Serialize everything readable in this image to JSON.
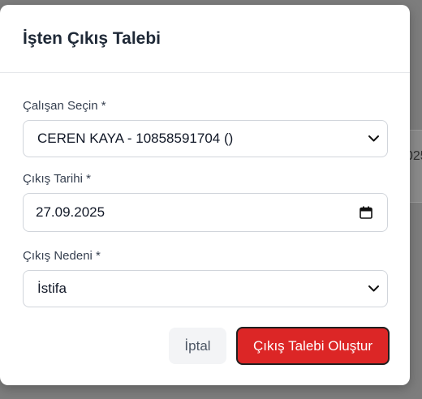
{
  "background": {
    "partial_text": "025"
  },
  "modal": {
    "title": "İşten Çıkış Talebi",
    "employee": {
      "label": "Çalışan Seçin *",
      "selected": "CEREN KAYA - 10858591704 ()"
    },
    "exit_date": {
      "label": "Çıkış Tarihi *",
      "value": "27.09.2025"
    },
    "exit_reason": {
      "label": "Çıkış Nedeni *",
      "selected": "İstifa"
    },
    "buttons": {
      "cancel": "İptal",
      "submit": "Çıkış Talebi Oluştur"
    }
  },
  "icons": {
    "select": "chevron-down-icon",
    "date": "calendar-icon"
  },
  "colors": {
    "primary": "#dc2626",
    "cancel_bg": "#f3f4f6",
    "overlay": "#7d7d7d"
  }
}
